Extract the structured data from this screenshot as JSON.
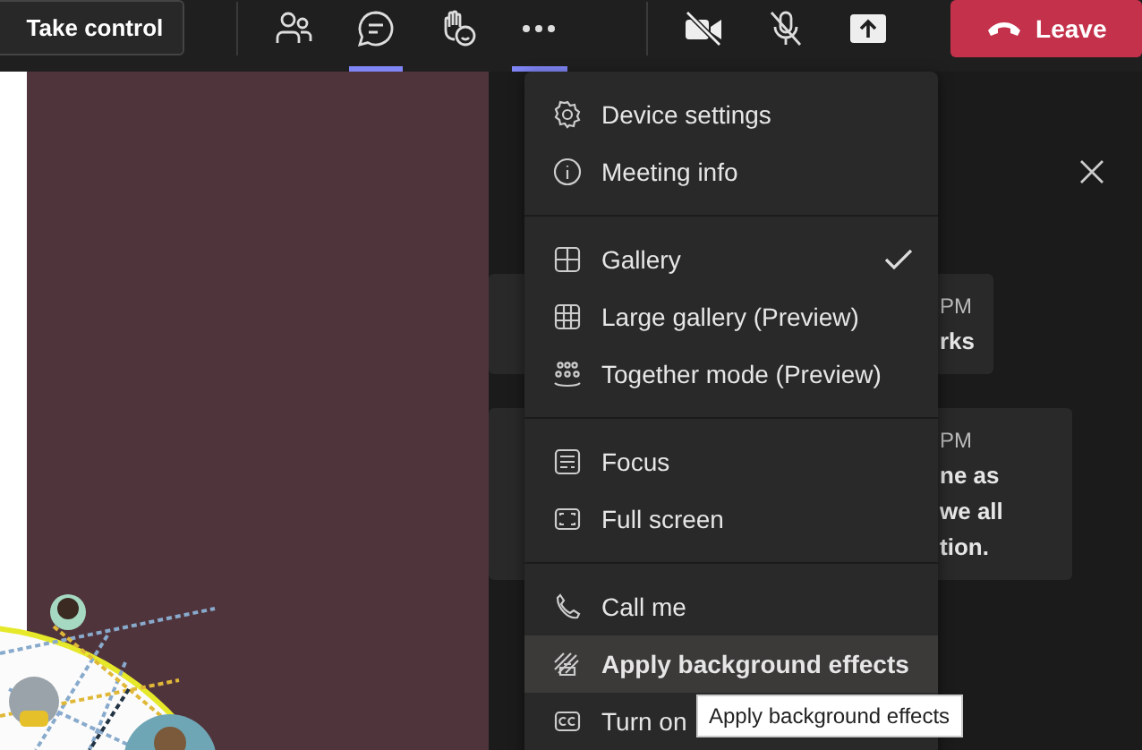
{
  "toolbar": {
    "take_control": "Take control",
    "icons": [
      {
        "selected": false
      },
      {
        "selected": true
      },
      {
        "selected": false
      },
      {
        "selected": true
      },
      {
        "selected": false
      },
      {
        "selected": false
      },
      {
        "selected": false
      }
    ],
    "leave": "Leave"
  },
  "chat": {
    "messages": [
      {
        "lines": [
          "PM",
          "rks"
        ]
      },
      {
        "lines": [
          "PM",
          "ne as",
          "we all",
          "tion."
        ]
      }
    ]
  },
  "menu": {
    "sections": [
      [
        {
          "label": "Device settings",
          "hovered": false
        },
        {
          "label": "Meeting info",
          "hovered": false
        }
      ],
      [
        {
          "label": "Gallery",
          "checked": true,
          "hovered": false
        },
        {
          "label": "Large gallery (Preview)",
          "checked": false,
          "hovered": false
        },
        {
          "label": "Together mode (Preview)",
          "checked": false,
          "hovered": false
        }
      ],
      [
        {
          "label": "Focus",
          "hovered": false
        },
        {
          "label": "Full screen",
          "hovered": false
        }
      ],
      [
        {
          "label": "Call me",
          "hovered": false
        },
        {
          "label": "Apply background effects",
          "hovered": true
        },
        {
          "label": "Turn on",
          "hovered": false
        }
      ]
    ]
  },
  "tooltip": "Apply background effects"
}
